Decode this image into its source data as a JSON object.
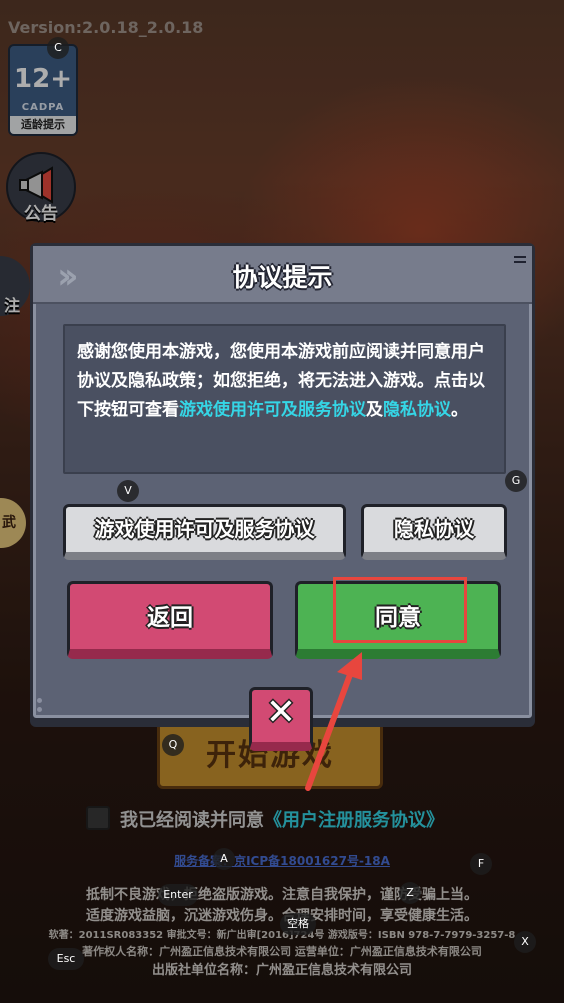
{
  "version": "Version:2.0.18_2.0.18",
  "age_badge": {
    "rating": "12+",
    "org": "CADPA",
    "tip": "适龄提示"
  },
  "side": {
    "announcement": "公告",
    "register_partial": "注",
    "partial3": "武"
  },
  "dialog": {
    "title": "协议提示",
    "body_prefix": "感谢您使用本游戏，您使用本游戏前应阅读并同意用户协议及隐私政策；如您拒绝，将无法进入游戏。点击以下按钮可查看",
    "body_link1": "游戏使用许可及服务协议",
    "body_and": "及",
    "body_link2": "隐私协议",
    "body_end": "。",
    "terms_button": "游戏使用许可及服务协议",
    "privacy_button": "隐私协议",
    "back_button": "返回",
    "agree_button": "同意",
    "close_glyph": "✕"
  },
  "start_button": "开始游戏",
  "agree_row": {
    "text": "我已经阅读并同意",
    "link": "《用户注册服务协议》"
  },
  "icp": "服务备案：京ICP备18001627号-18A",
  "footer": {
    "line1": "抵制不良游戏，拒绝盗版游戏。注意自我保护，谨防受骗上当。",
    "line2": "适度游戏益脑，沉迷游戏伤身。合理安排时间，享受健康生活。",
    "line3": "软著：2011SR083352 审批文号：新广出审[2016]724号 游戏版号：ISBN 978-7-7979-3257-8",
    "line4": "著作权人名称：广州盈正信息技术有限公司   运营单位：广州盈正信息技术有限公司",
    "line5": "出版社单位名称：广州盈正信息技术有限公司"
  },
  "key_hints": {
    "c": "C",
    "v": "V",
    "g": "G",
    "q": "Q",
    "a": "A",
    "f": "F",
    "enter": "Enter",
    "z": "Z",
    "space": "空格",
    "x": "X",
    "esc": "Esc"
  },
  "colors": {
    "link": "#35d6e6",
    "agree": "#4db353",
    "back": "#d24a73",
    "highlight": "#e8463e"
  }
}
